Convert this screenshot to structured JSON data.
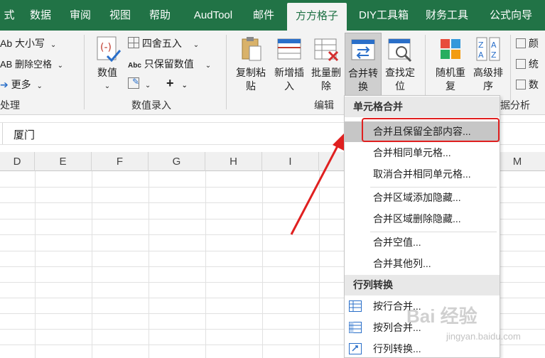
{
  "tabs": [
    "式",
    "数据",
    "审阅",
    "视图",
    "帮助",
    "AudTool",
    "邮件",
    "方方格子",
    "DIY工具箱",
    "财务工具",
    "公式向导"
  ],
  "active_tab": "方方格子",
  "ribbon": {
    "text_group": {
      "case_label": "Ab 大小写",
      "trim_label": "AB 删除空格",
      "more_label": "更多",
      "group_label": "处理"
    },
    "numeric_group": {
      "value_label": "数值",
      "round_label": "四舍五入",
      "keep_value_label": "只保留数值",
      "group_label": "数值录入"
    },
    "edit_group": {
      "copy_paste_label": "复制粘贴",
      "insert_label": "新增插入",
      "batch_delete_label": "批量删除",
      "merge_label": "合并转换",
      "find_label": "查找定位",
      "group_label": "编辑"
    },
    "analysis_group": {
      "random_label": "随机重复",
      "sort_label": "高级排序",
      "color_label": "颜",
      "stats_label": "统",
      "data_label": "数",
      "group_label": "据分析"
    }
  },
  "formula_bar": {
    "value": "厦门"
  },
  "columns": [
    "D",
    "E",
    "F",
    "G",
    "H",
    "I",
    "M"
  ],
  "menu": {
    "section1_title": "单元格合并",
    "items1": [
      "合并且保留全部内容...",
      "合并相同单元格...",
      "取消合并相同单元格...",
      "合并区域添加隐藏...",
      "合并区域删除隐藏...",
      "合并空值...",
      "合并其他列..."
    ],
    "section2_title": "行列转换",
    "items2": [
      "按行合并...",
      "按列合并...",
      "行列转换..."
    ]
  },
  "watermark": {
    "main": "Bai 经验",
    "sub": "jingyan.baidu.com"
  },
  "colors": {
    "excel_green": "#217346",
    "highlight_red": "#e02020",
    "menu_highlight": "#c6c6c6"
  }
}
